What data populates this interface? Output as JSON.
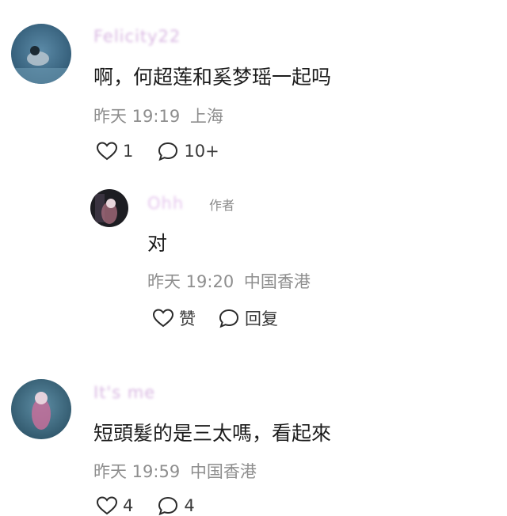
{
  "comments": [
    {
      "username": "Felicity22",
      "text": "啊，何超莲和奚梦瑶一起吗",
      "time": "昨天 19:19",
      "location": "上海",
      "likes": "1",
      "replies": "10+",
      "avatar_colors": {
        "bg": "#3f6f8d",
        "accent": "#b9c6cf"
      },
      "name_color": "#d9b8e2"
    },
    {
      "username": "Ohh",
      "author_tag": "作者",
      "text": "对",
      "time": "昨天 19:20",
      "location": "中国香港",
      "like_label": "赞",
      "reply_label": "回复",
      "avatar_colors": {
        "bg": "#1d1d22",
        "accent": "#a46a7a"
      },
      "name_color": "#e6c7ee"
    },
    {
      "username": "It's me",
      "text": "短頭髮的是三太嗎，看起來",
      "time": "昨天 19:59",
      "location": "中国香港",
      "likes": "4",
      "replies": "4",
      "avatar_colors": {
        "bg": "#2e5c73",
        "accent": "#c66f9a"
      },
      "name_color": "#d9b8e2"
    }
  ]
}
